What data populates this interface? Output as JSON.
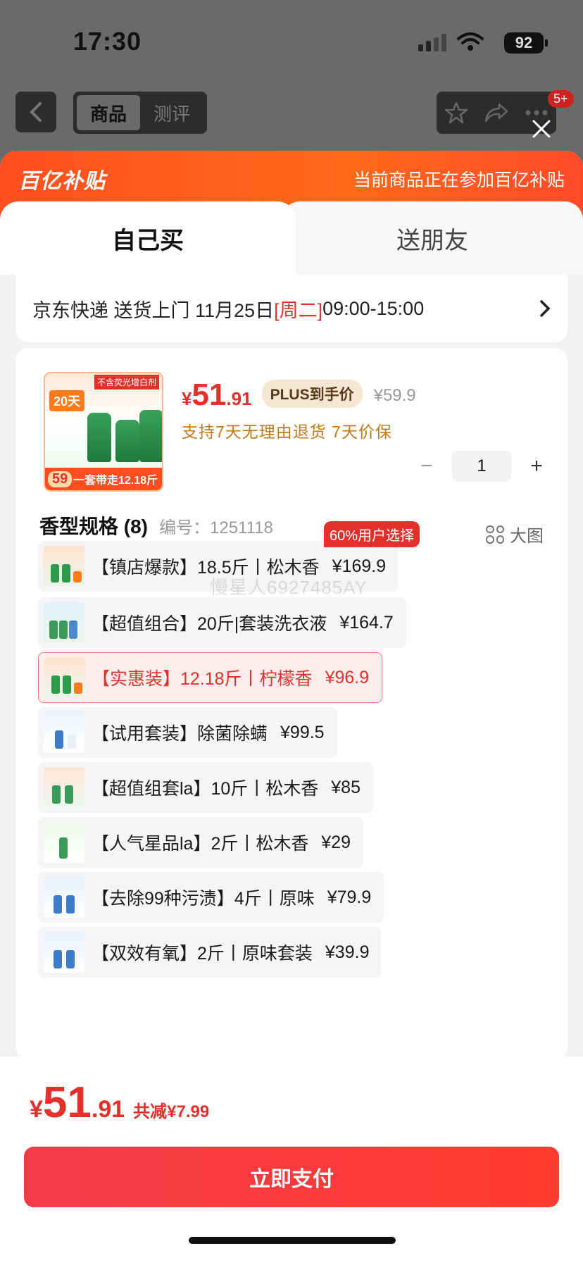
{
  "status_bar": {
    "time": "17:30",
    "battery": "92"
  },
  "nav": {
    "tabs": [
      {
        "label": "商品",
        "active": true
      },
      {
        "label": "测评",
        "active": false
      }
    ],
    "badge": "5+"
  },
  "banner": {
    "logo": "百亿补贴",
    "note": "当前商品正在参加百亿补贴"
  },
  "purchase_tabs": {
    "self": "自己买",
    "gift": "送朋友"
  },
  "delivery": {
    "carrier": "京东快递 送货上门 11月25日 ",
    "weekday": "[周二]",
    "window": " 09:00-15:00"
  },
  "product": {
    "thumb_label_top": "20天",
    "thumb_label_red": "不含荧光增白剂",
    "thumb_price": "59",
    "thumb_footer": "一套带走12.18斤",
    "price_yen": "¥",
    "price_int": "51",
    "price_dec": ".91",
    "plus_tag": "PLUS到手价",
    "original_price": "¥59.9",
    "services": "支持7天无理由退货   7天价保",
    "quantity": "1"
  },
  "spec": {
    "title": "香型规格 (8)",
    "code": "编号：1251118",
    "big_image": "大图",
    "popular_badge": "60%用户选择",
    "options": [
      {
        "label": "【镇店爆款】18.5斤丨松木香",
        "price": "¥169.9",
        "selected": false
      },
      {
        "label": "【超值组合】20斤|套装洗衣液",
        "price": "¥164.7",
        "selected": false
      },
      {
        "label": "【实惠装】12.18斤丨柠檬香",
        "price": "¥96.9",
        "selected": true
      },
      {
        "label": "【试用套装】除菌除螨",
        "price": "¥99.5",
        "selected": false
      },
      {
        "label": "【超值组套la】10斤丨松木香",
        "price": "¥85",
        "selected": false
      },
      {
        "label": "【人气星品la】2斤丨松木香",
        "price": "¥29",
        "selected": false
      },
      {
        "label": "【去除99种污渍】4斤丨原味",
        "price": "¥79.9",
        "selected": false
      },
      {
        "label": "【双效有氧】2斤丨原味套装",
        "price": "¥39.9",
        "selected": false
      }
    ]
  },
  "watermark": "慢星人6927485AY",
  "footer": {
    "total_yen": "¥",
    "total_int": "51",
    "total_dec": ".91",
    "savings": "共减¥7.99",
    "pay_label": "立即支付"
  },
  "colors": {
    "accent": "#e3302b",
    "banner": "#ff5a1f",
    "plus": "#f6e7d3"
  },
  "icons": [
    "back-icon",
    "star-icon",
    "share-icon",
    "more-icon",
    "close-icon",
    "chevron-right-icon",
    "grid-icon",
    "wifi-icon",
    "signal-icon"
  ]
}
